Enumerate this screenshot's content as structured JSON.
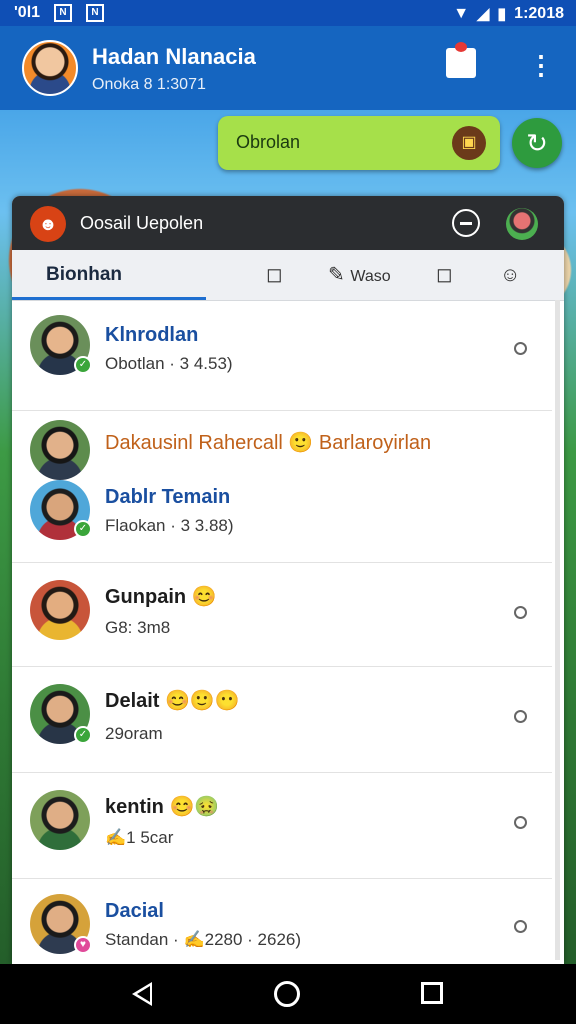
{
  "status_bar": {
    "left_text": "'0l1",
    "time": "1:2018"
  },
  "app_bar": {
    "title": "Hadan Nlanacia",
    "subtitle": "Onoka 8 1:3071"
  },
  "quick_pill": {
    "label": "Obrolan"
  },
  "panel": {
    "title": "Oosail Uepolen",
    "active_tab": "Bionhan",
    "tab_label_2": "Waso"
  },
  "chats": [
    {
      "name": "Klnrodlan",
      "name_color": "#1a4fa0",
      "sub": "Obotlan · 3 4.53)",
      "badge_color": "#3aa53a",
      "badge_icon": "check-icon"
    },
    {
      "name": "Dakausinl Rahercall 🙂 Barlaroyirlan",
      "name_color": "#c0611a",
      "sub": "",
      "badge_color": "",
      "badge_icon": ""
    },
    {
      "name": "Dablr Temain",
      "name_color": "#1a4fa0",
      "sub": "Flaokan · 3 3.88)",
      "badge_color": "#3aa53a",
      "badge_icon": "check-icon"
    },
    {
      "name": "Gunpain 😊",
      "name_color": "#1d1d1d",
      "sub": "G8: 3m8",
      "badge_color": "",
      "badge_icon": ""
    },
    {
      "name": "Delait 😊🙂😶",
      "name_color": "#1d1d1d",
      "sub": "29oram",
      "badge_color": "#3aa53a",
      "badge_icon": "check-icon"
    },
    {
      "name": "kentin 😊🤢",
      "name_color": "#1d1d1d",
      "sub": "✍1 5car",
      "badge_color": "",
      "badge_icon": ""
    },
    {
      "name": "Dacial",
      "name_color": "#1a4fa0",
      "sub": "Standan · ✍2280 · 2626)",
      "badge_color": "#e04a9a",
      "badge_icon": "heart-icon"
    }
  ],
  "accent_color": "#1565c0"
}
